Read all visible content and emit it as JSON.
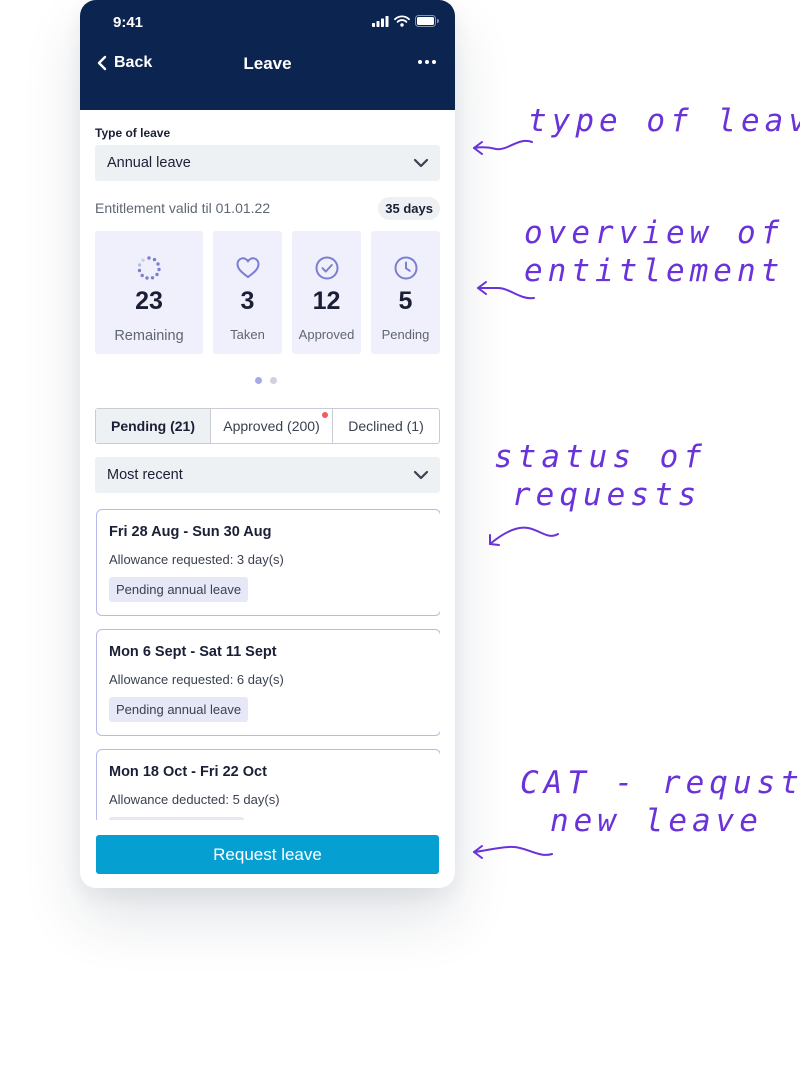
{
  "status_bar": {
    "time": "9:41"
  },
  "nav": {
    "back_label": "Back",
    "title": "Leave"
  },
  "leave_type": {
    "label": "Type of leave",
    "value": "Annual leave"
  },
  "entitlement": {
    "text": "Entitlement valid til 01.01.22",
    "total": "35 days"
  },
  "stats": [
    {
      "icon": "progress-icon",
      "value": "23",
      "label": "Remaining"
    },
    {
      "icon": "heart-icon",
      "value": "3",
      "label": "Taken"
    },
    {
      "icon": "check-circle-icon",
      "value": "12",
      "label": "Approved"
    },
    {
      "icon": "clock-icon",
      "value": "5",
      "label": "Pending"
    }
  ],
  "pager": {
    "pages": 2,
    "active": 1
  },
  "tabs": [
    {
      "label": "Pending (21)",
      "active": true
    },
    {
      "label": "Approved (200)",
      "active": false,
      "has_notification": true
    },
    {
      "label": "Declined (1)",
      "active": false
    }
  ],
  "sort": {
    "value": "Most recent"
  },
  "requests": [
    {
      "dates": "Fri 28 Aug - Sun 30 Aug",
      "allowance": "Allowance requested: 3 day(s)",
      "status": "Pending annual leave"
    },
    {
      "dates": "Mon 6 Sept - Sat 11 Sept",
      "allowance": "Allowance requested: 6 day(s)",
      "status": "Pending annual leave"
    },
    {
      "dates": "Mon 18 Oct - Fri 22 Oct",
      "allowance": "Allowance deducted: 5 day(s)",
      "status": ""
    }
  ],
  "cta": {
    "label": "Request leave"
  },
  "annotations": [
    {
      "lines": [
        "type of leave"
      ]
    },
    {
      "lines": [
        "overview of",
        "entitlement"
      ]
    },
    {
      "lines": [
        "status of",
        "requests"
      ]
    },
    {
      "lines": [
        "CAT - requst",
        "new leave"
      ]
    }
  ],
  "colors": {
    "header": "#0c2450",
    "primary": "#05a0d1",
    "stat_bg": "#eff0fb",
    "stat_icon": "#7b7fd1",
    "card_border": "#b9b9ec",
    "tag_bg": "#e6e7f7",
    "notification": "#ef5b61",
    "annotation": "#6a32d9"
  }
}
